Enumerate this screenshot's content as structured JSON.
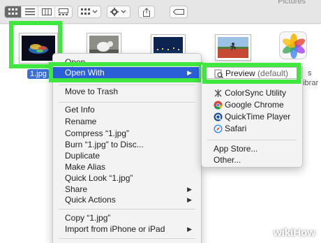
{
  "window": {
    "title_partial": "Pictures"
  },
  "toolbar": {
    "view_icons": [
      "icon-view-icon",
      "list-view-icon",
      "column-view-icon",
      "gallery-view-icon"
    ],
    "group_icon": "group-by-icon",
    "action_icon": "gear-icon",
    "share_icon": "share-icon",
    "tag_icon": "tag-icon"
  },
  "files": [
    {
      "label": "1.jpg",
      "selected": true
    },
    {
      "label": ""
    },
    {
      "label": ""
    },
    {
      "label": ""
    },
    {
      "label": "s"
    },
    {
      "label": "Librar"
    }
  ],
  "context_menu": {
    "items": [
      {
        "label": "Open"
      },
      {
        "label": "Open With",
        "submenu": true,
        "selected": true
      },
      {
        "label": "Move to Trash"
      },
      {
        "label": "Get Info"
      },
      {
        "label": "Rename"
      },
      {
        "label": "Compress “1.jpg”"
      },
      {
        "label": "Burn “1.jpg” to Disc..."
      },
      {
        "label": "Duplicate"
      },
      {
        "label": "Make Alias"
      },
      {
        "label": "Quick Look “1.jpg”"
      },
      {
        "label": "Share",
        "submenu": true
      },
      {
        "label": "Quick Actions",
        "submenu": true
      },
      {
        "label": "Copy “1.jpg”"
      },
      {
        "label": "Import from iPhone or iPad",
        "submenu": true
      }
    ],
    "arrow_glyph": "▶"
  },
  "open_with_menu": {
    "default_app": {
      "name": "Preview",
      "suffix": "(default)"
    },
    "apps": [
      {
        "name": "ColorSync Utility",
        "icon": "colorsync-icon"
      },
      {
        "name": "Google Chrome",
        "icon": "chrome-icon"
      },
      {
        "name": "QuickTime Player",
        "icon": "quicktime-icon"
      },
      {
        "name": "Safari",
        "icon": "safari-icon"
      }
    ],
    "extra": [
      {
        "label": "App Store..."
      },
      {
        "label": "Other..."
      }
    ]
  },
  "watermark": {
    "wiki": "wiki",
    "how": "How"
  },
  "colors": {
    "highlight": "#3ee83e",
    "menu_selection": "#2a5fd8",
    "file_selection": "#3b6fd6"
  }
}
